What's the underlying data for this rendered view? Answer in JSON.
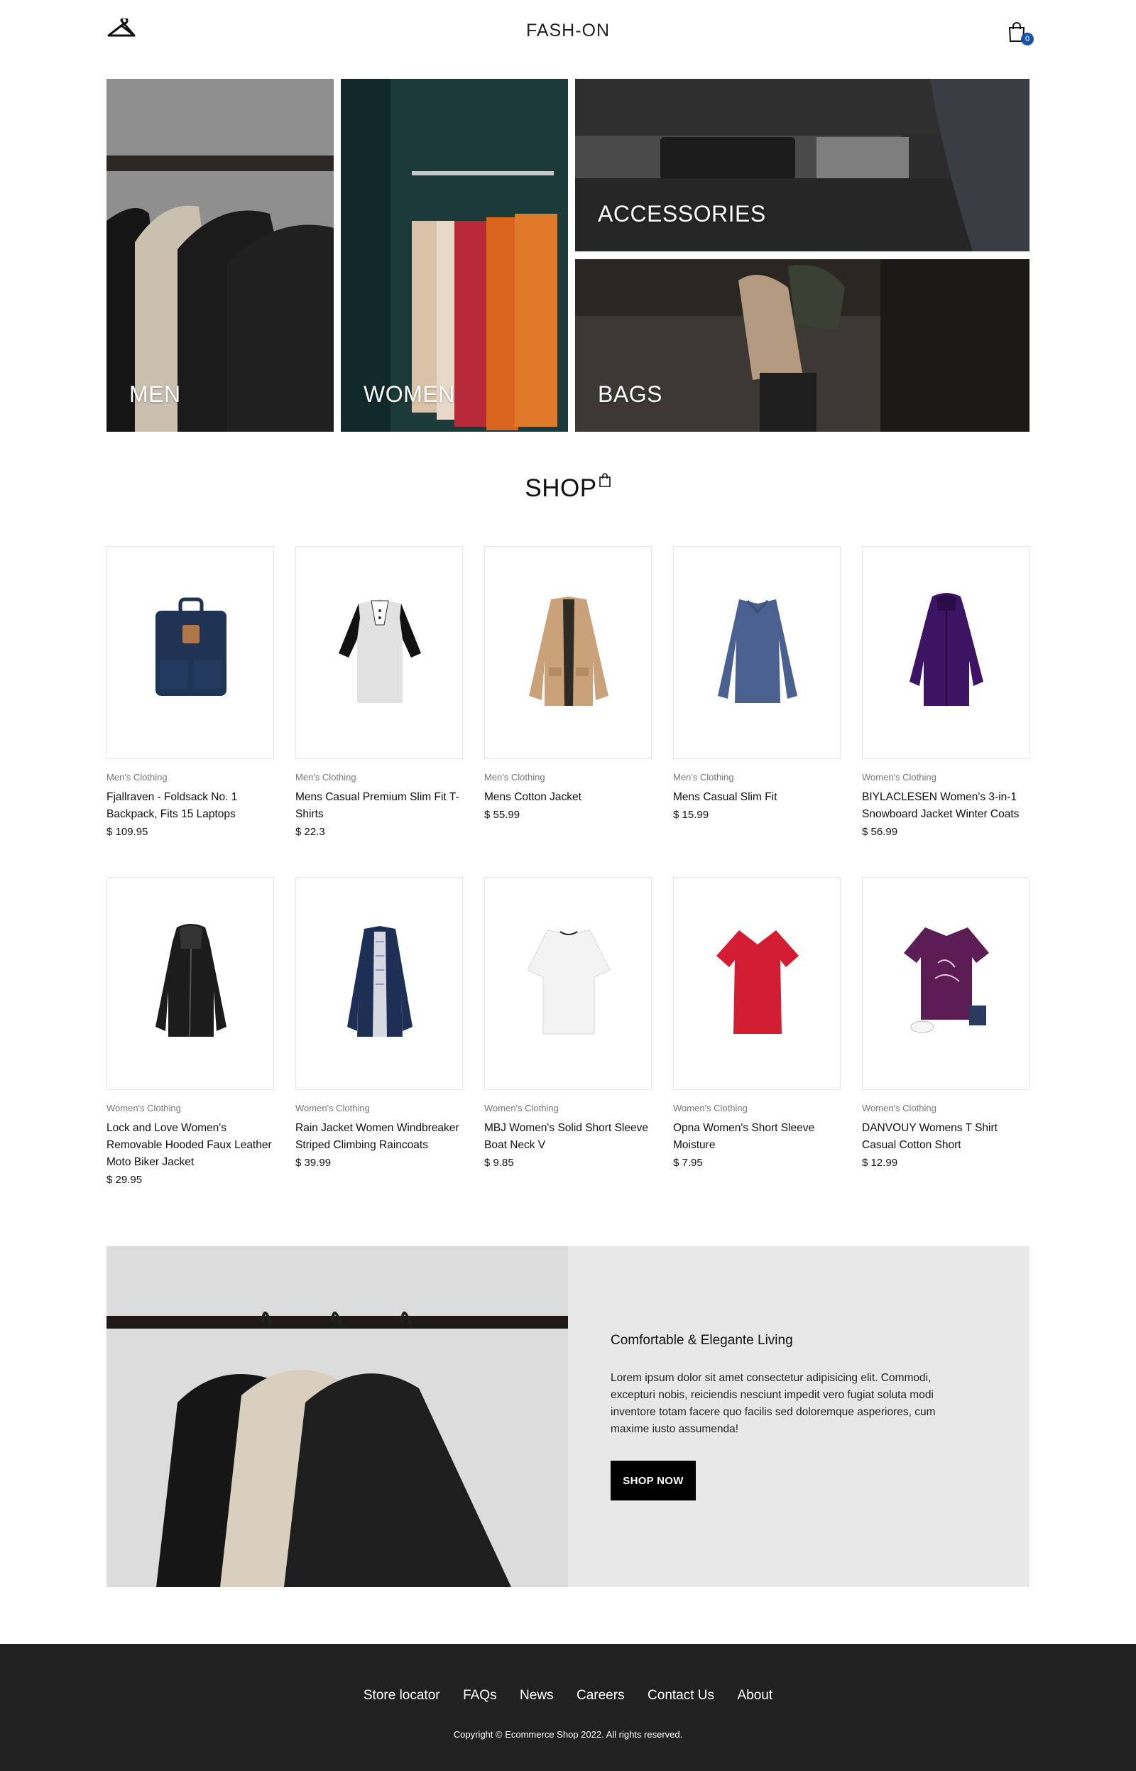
{
  "header": {
    "brand": "FASH-ON",
    "cart_count": "0"
  },
  "hero": {
    "tiles": [
      {
        "label": "MEN"
      },
      {
        "label": "WOMEN"
      },
      {
        "label": "ACCESSORIES"
      },
      {
        "label": "BAGS"
      }
    ]
  },
  "shop": {
    "title": "SHOP"
  },
  "products": [
    {
      "category": "Men's Clothing",
      "name": "Fjallraven - Foldsack No. 1 Backpack, Fits 15 Laptops",
      "price": "$ 109.95",
      "icon": "backpack"
    },
    {
      "category": "Men's Clothing",
      "name": "Mens Casual Premium Slim Fit T-Shirts",
      "price": "$ 22.3",
      "icon": "raglan-tshirt"
    },
    {
      "category": "Men's Clothing",
      "name": "Mens Cotton Jacket",
      "price": "$ 55.99",
      "icon": "cotton-jacket"
    },
    {
      "category": "Men's Clothing",
      "name": "Mens Casual Slim Fit",
      "price": "$ 15.99",
      "icon": "long-sleeve-shirt"
    },
    {
      "category": "Women's Clothing",
      "name": "BIYLACLESEN Women's 3-in-1 Snowboard Jacket Winter Coats",
      "price": "$ 56.99",
      "icon": "purple-jacket"
    },
    {
      "category": "Women's Clothing",
      "name": "Lock and Love Women's Removable Hooded Faux Leather Moto Biker Jacket",
      "price": "$ 29.95",
      "icon": "leather-jacket"
    },
    {
      "category": "Women's Clothing",
      "name": "Rain Jacket Women Windbreaker Striped Climbing Raincoats",
      "price": "$ 39.99",
      "icon": "rain-jacket"
    },
    {
      "category": "Women's Clothing",
      "name": "MBJ Women's Solid Short Sleeve Boat Neck V",
      "price": "$ 9.85",
      "icon": "white-top"
    },
    {
      "category": "Women's Clothing",
      "name": "Opna Women's Short Sleeve Moisture",
      "price": "$ 7.95",
      "icon": "red-tshirt"
    },
    {
      "category": "Women's Clothing",
      "name": "DANVOUY Womens T Shirt Casual Cotton Short",
      "price": "$ 12.99",
      "icon": "purple-tshirt"
    }
  ],
  "banner": {
    "title": "Comfortable & Elegante Living",
    "text": "Lorem ipsum dolor sit amet consectetur adipisicing elit. Commodi, excepturi nobis, reiciendis nesciunt impedit vero fugiat soluta modi inventore totam facere quo facilis sed doloremque asperiores, cum maxime iusto assumenda!",
    "button": "SHOP NOW"
  },
  "footer": {
    "links": [
      "Store locator",
      "FAQs",
      "News",
      "Careers",
      "Contact Us",
      "About"
    ],
    "copyright": "Copyright © Ecommerce Shop 2022. All rights reserved."
  },
  "colors": {
    "footer_bg": "#212121",
    "badge": "#1a52a8",
    "button": "#000000"
  }
}
